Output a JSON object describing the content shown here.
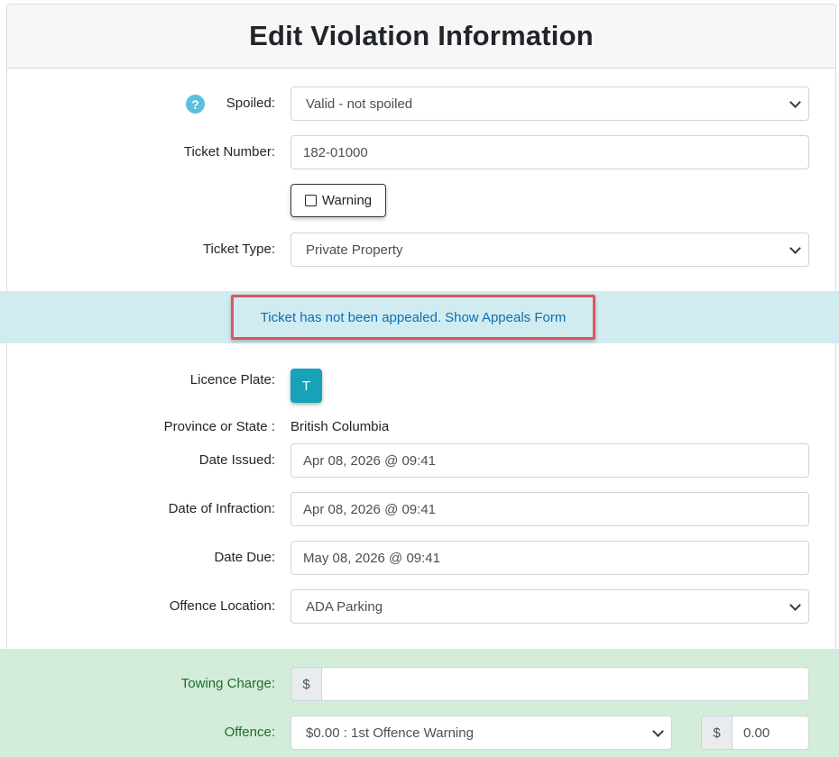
{
  "title": "Edit Violation Information",
  "spoiled": {
    "label": "Spoiled:",
    "help_icon": "question-circle-icon",
    "value": "Valid - not spoiled"
  },
  "ticket_number": {
    "label": "Ticket Number:",
    "value": "182-01000"
  },
  "warning": {
    "label": "Warning",
    "checked": false
  },
  "ticket_type": {
    "label": "Ticket Type:",
    "value": "Private Property"
  },
  "appeal": {
    "status_text": "Ticket has not been appealed.",
    "link_text": "Show Appeals Form"
  },
  "licence_plate": {
    "label": "Licence Plate:",
    "button_text": "T"
  },
  "province": {
    "label": "Province or State :",
    "value": "British Columbia"
  },
  "date_issued": {
    "label": "Date Issued:",
    "value": "Apr 08, 2026 @ 09:41"
  },
  "date_infraction": {
    "label": "Date of Infraction:",
    "value": "Apr 08, 2026 @ 09:41"
  },
  "date_due": {
    "label": "Date Due:",
    "value": "May 08, 2026 @ 09:41"
  },
  "offence_location": {
    "label": "Offence Location:",
    "value": "ADA Parking"
  },
  "towing_charge": {
    "label": "Towing Charge:",
    "currency": "$",
    "value": ""
  },
  "offence": {
    "label": "Offence:",
    "value": "$0.00 : 1st Offence Warning",
    "currency": "$",
    "amount": "0.00"
  },
  "colors": {
    "info_band": "#d1ecf1",
    "success_band": "#d4edda",
    "accent": "#17a2b8",
    "highlight_border": "#e0555a"
  }
}
